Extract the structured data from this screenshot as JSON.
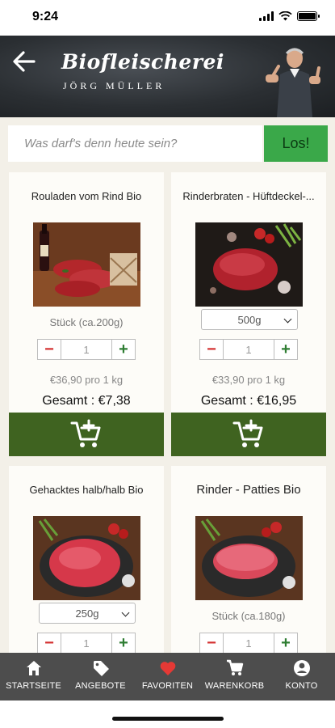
{
  "status": {
    "time": "9:24"
  },
  "header": {
    "brand_name": "Biofleischerei",
    "brand_sub": "JÖRG MÜLLER"
  },
  "search": {
    "placeholder": "Was darf's denn heute sein?",
    "button_label": "Los!"
  },
  "products": [
    {
      "title": "Rouladen vom Rind Bio",
      "unit_text": "Stück (ca.200g)",
      "quantity": "1",
      "price_per": "€36,90 pro 1 kg",
      "total": "Gesamt : €7,38"
    },
    {
      "title": "Rinderbraten - Hüftdeckel-...",
      "unit_select": "500g",
      "quantity": "1",
      "price_per": "€33,90 pro 1 kg",
      "total": "Gesamt : €16,95"
    },
    {
      "title": "Gehacktes halb/halb Bio",
      "unit_select": "250g",
      "quantity": "1"
    },
    {
      "title": "Rinder - Patties Bio",
      "unit_text": "Stück (ca.180g)",
      "quantity": "1"
    }
  ],
  "stepper": {
    "minus": "−",
    "plus": "+"
  },
  "tabs": [
    {
      "label": "STARTSEITE",
      "icon": "home-icon"
    },
    {
      "label": "ANGEBOTE",
      "icon": "tag-icon"
    },
    {
      "label": "FAVORITEN",
      "icon": "heart-icon"
    },
    {
      "label": "WARENKORB",
      "icon": "cart-icon"
    },
    {
      "label": "KONTO",
      "icon": "account-icon"
    }
  ],
  "colors": {
    "accent_green": "#3aa849",
    "cart_green": "#3f6320",
    "tabbar": "#4d4d4d",
    "favorite_red": "#e53935"
  }
}
